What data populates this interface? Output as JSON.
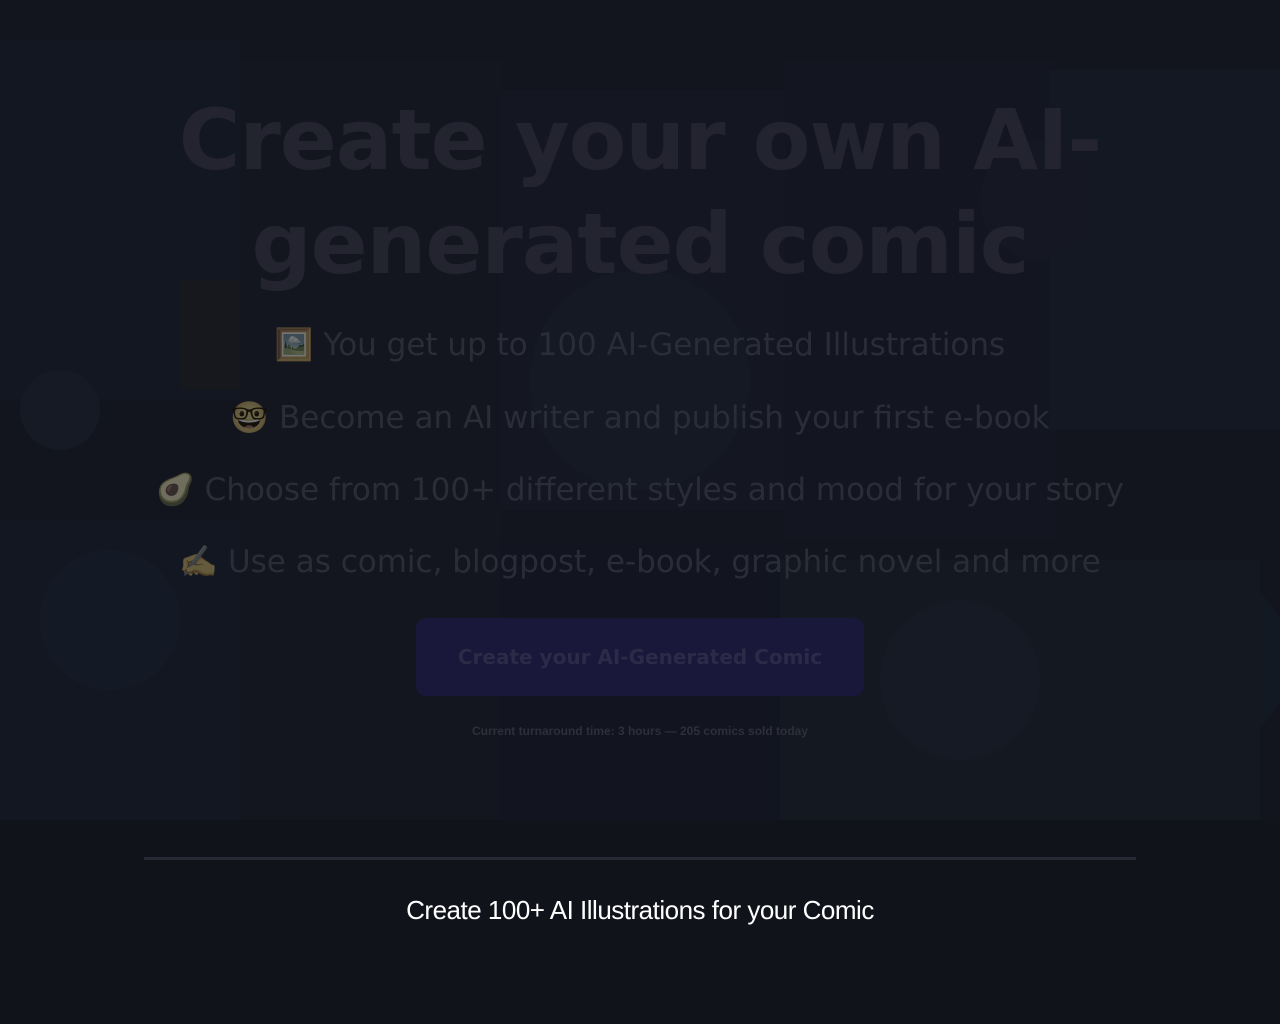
{
  "hero": {
    "title": "Create your own AI-generated comic",
    "features": [
      {
        "icon": "framed-picture-icon",
        "emoji": "🖼️",
        "text": "You get up to 100 AI-Generated Illustrations"
      },
      {
        "icon": "nerd-face-icon",
        "emoji": "🤓",
        "text": "Become an AI writer and publish your first e-book"
      },
      {
        "icon": "avocado-icon",
        "emoji": "🥑",
        "text": "Choose from 100+ different styles and mood for your story"
      },
      {
        "icon": "writing-hand-icon",
        "emoji": "✍️",
        "text": "Use as comic, blogpost, e-book, graphic novel and more"
      }
    ],
    "cta_label": "Create your AI-Generated Comic",
    "turnaround": "Current turnaround time: 3 hours — 205 comics sold today"
  },
  "section": {
    "title": "Create 100+ AI Illustrations for your Comic"
  },
  "colors": {
    "page_background": "#11131b",
    "cta_background": "#19173a",
    "section_title": "#ffffff"
  }
}
